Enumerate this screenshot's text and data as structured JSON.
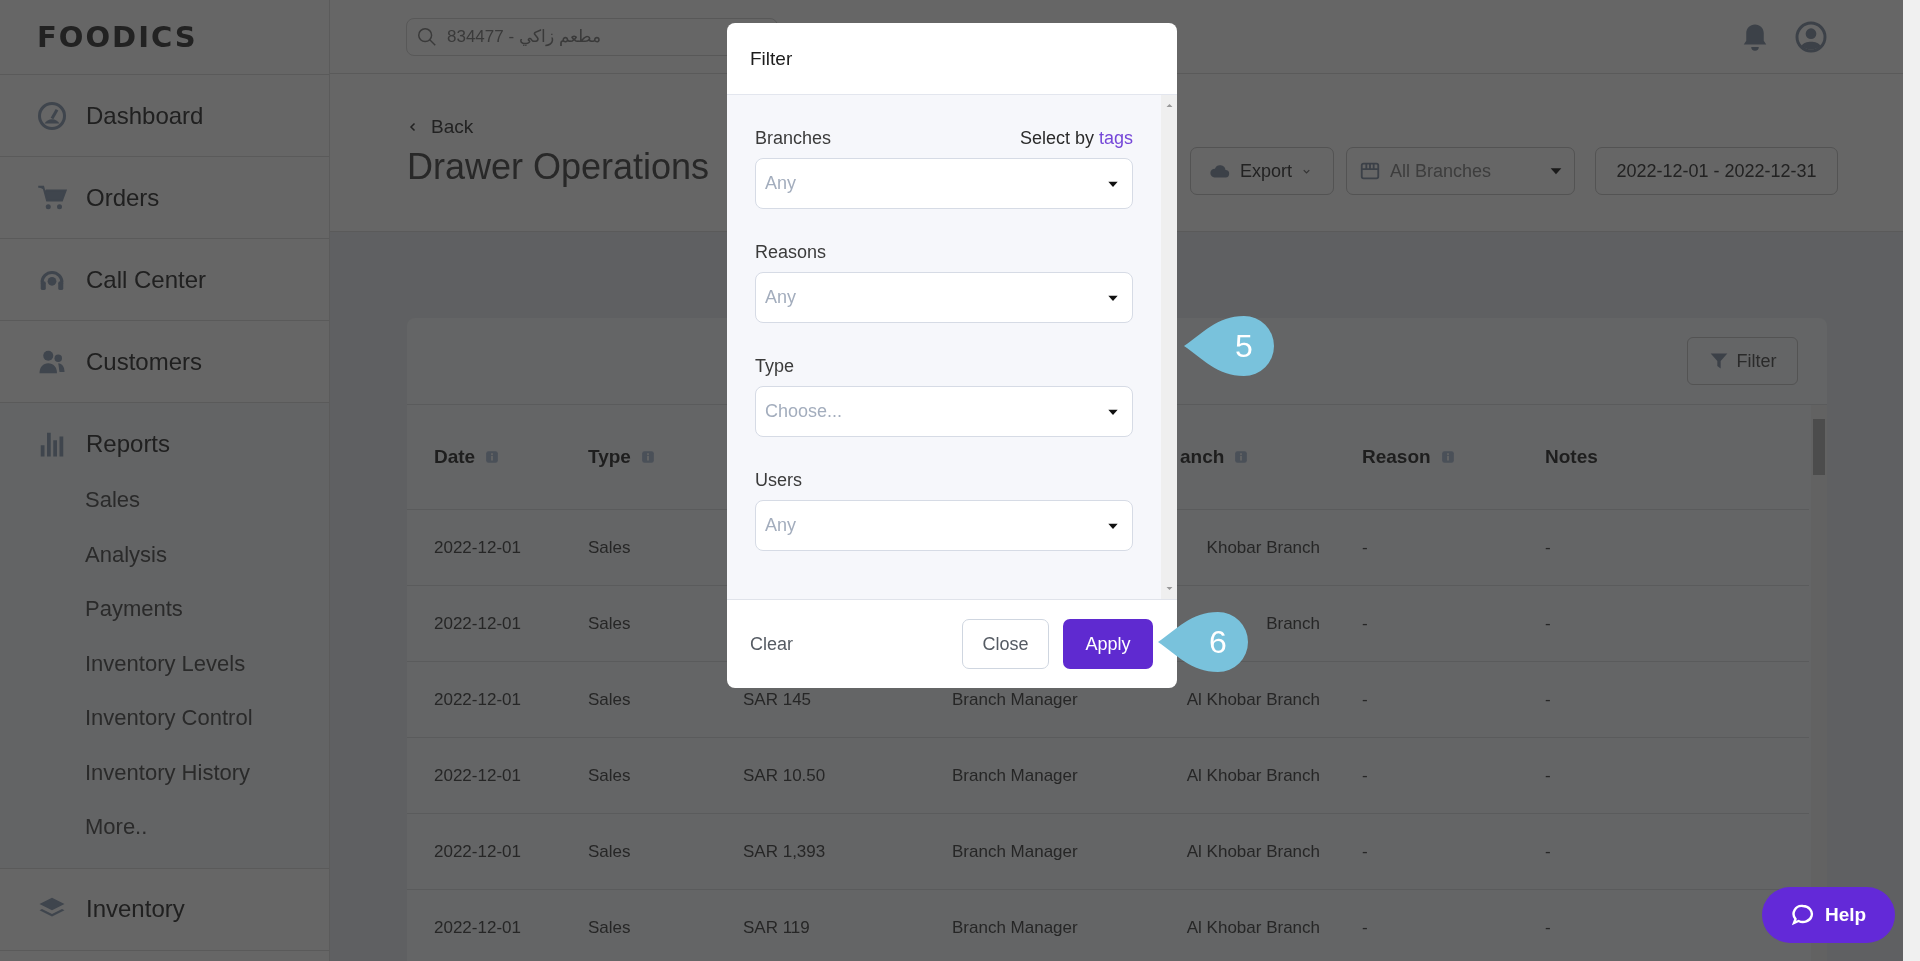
{
  "logo": "FOODICS",
  "search": {
    "placeholder": "834477 - مطعم زاكي"
  },
  "sidebar": {
    "items": [
      {
        "label": "Dashboard",
        "expanded": false
      },
      {
        "label": "Orders",
        "expanded": false
      },
      {
        "label": "Call Center",
        "expanded": false
      },
      {
        "label": "Customers",
        "expanded": false
      },
      {
        "label": "Reports",
        "expanded": true,
        "children": [
          {
            "label": "Sales"
          },
          {
            "label": "Analysis"
          },
          {
            "label": "Payments"
          },
          {
            "label": "Inventory Levels"
          },
          {
            "label": "Inventory Control"
          },
          {
            "label": "Inventory History"
          },
          {
            "label": "More.."
          }
        ]
      },
      {
        "label": "Inventory",
        "expanded": false
      }
    ]
  },
  "header": {
    "back": "Back",
    "title": "Drawer Operations",
    "export": "Export",
    "branches": "All Branches",
    "date_range": "2022-12-01 - 2022-12-31"
  },
  "table": {
    "filter_button": "Filter",
    "columns": [
      {
        "label": "Date",
        "info": true
      },
      {
        "label": "Type",
        "info": true
      },
      null,
      null,
      {
        "label": "anch",
        "info": true
      },
      {
        "label": "Reason",
        "info": true
      },
      {
        "label": "Notes",
        "info": false
      }
    ],
    "rows": [
      [
        "2022-12-01",
        "Sales",
        null,
        null,
        "Khobar Branch",
        "-",
        "-"
      ],
      [
        "2022-12-01",
        "Sales",
        null,
        null,
        "Branch",
        "-",
        "-"
      ],
      [
        "2022-12-01",
        "Sales",
        "SAR 145",
        "Branch Manager",
        "Al Khobar Branch",
        "-",
        "-"
      ],
      [
        "2022-12-01",
        "Sales",
        "SAR 10.50",
        "Branch Manager",
        "Al Khobar Branch",
        "-",
        "-"
      ],
      [
        "2022-12-01",
        "Sales",
        "SAR 1,393",
        "Branch Manager",
        "Al Khobar Branch",
        "-",
        "-"
      ],
      [
        "2022-12-01",
        "Sales",
        "SAR 119",
        "Branch Manager",
        "Al Khobar Branch",
        "-",
        "-"
      ]
    ]
  },
  "modal": {
    "title": "Filter",
    "fields": [
      {
        "label": "Branches",
        "placeholder": "Any",
        "side_text": "Select by ",
        "side_link": "tags"
      },
      {
        "label": "Reasons",
        "placeholder": "Any"
      },
      {
        "label": "Type",
        "placeholder": "Choose..."
      },
      {
        "label": "Users",
        "placeholder": "Any"
      }
    ],
    "clear": "Clear",
    "close": "Close",
    "apply": "Apply"
  },
  "markers": [
    "5",
    "6"
  ],
  "help": "Help"
}
